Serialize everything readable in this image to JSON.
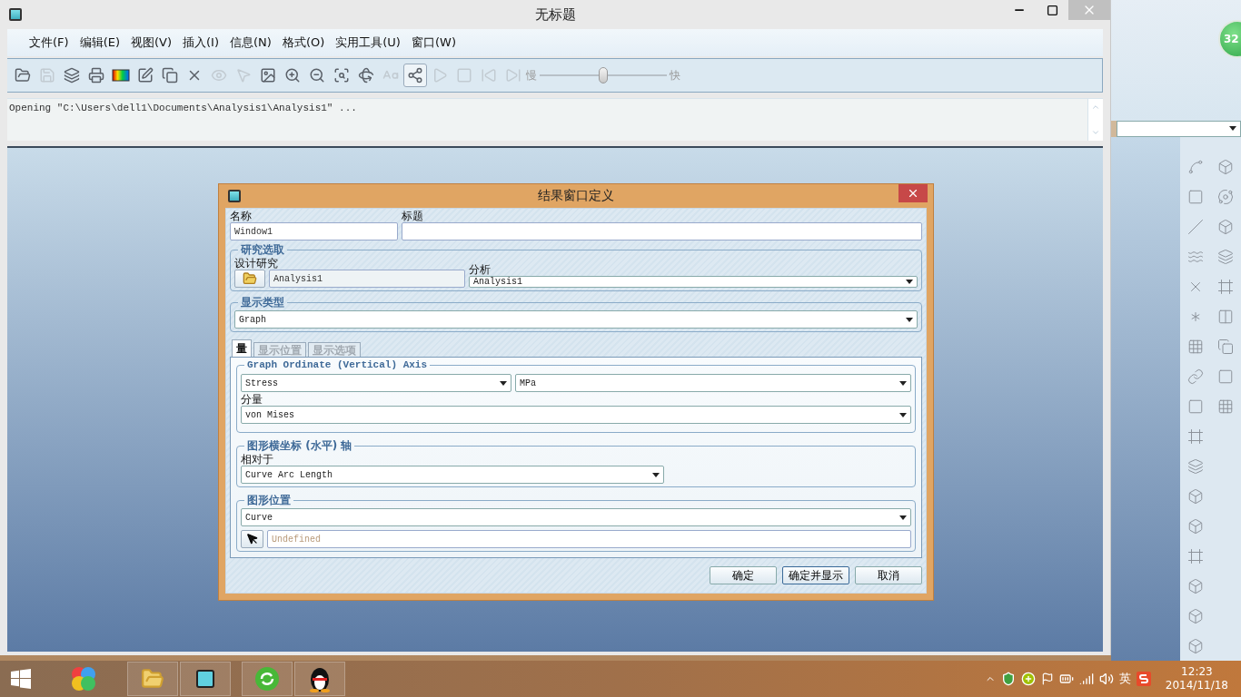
{
  "window": {
    "title": "无标题"
  },
  "menu": [
    "文件(F)",
    "编辑(E)",
    "视图(V)",
    "插入(I)",
    "信息(N)",
    "格式(O)",
    "实用工具(U)",
    "窗口(W)"
  ],
  "toolbar": {
    "tools": [
      {
        "disabled": false,
        "selected": false
      },
      {
        "disabled": true,
        "selected": false
      },
      {
        "disabled": false,
        "selected": false
      },
      {
        "disabled": false,
        "selected": false
      },
      {
        "disabled": false,
        "selected": false
      },
      {
        "disabled": false,
        "selected": false
      },
      {
        "disabled": false,
        "selected": false
      },
      {
        "disabled": false,
        "selected": false
      },
      {
        "disabled": true,
        "selected": false
      },
      {
        "disabled": true,
        "selected": false
      },
      {
        "disabled": false,
        "selected": false
      },
      {
        "disabled": false,
        "selected": false
      },
      {
        "disabled": false,
        "selected": false
      },
      {
        "disabled": false,
        "selected": false
      },
      {
        "disabled": false,
        "selected": false
      },
      {
        "disabled": true,
        "selected": false
      },
      {
        "disabled": false,
        "selected": true
      },
      {
        "disabled": true,
        "selected": false
      },
      {
        "disabled": true,
        "selected": false
      },
      {
        "disabled": true,
        "selected": false
      },
      {
        "disabled": true,
        "selected": false
      }
    ],
    "slow_label": "慢",
    "fast_label": "快",
    "speed": {
      "level": 0.5
    }
  },
  "output": {
    "text": "Opening \"C:\\Users\\dell1\\Documents\\Analysis1\\Analysis1\" ..."
  },
  "dialog": {
    "title": "结果窗口定义",
    "name_label": "名称",
    "name_value": "Window1",
    "title_label": "标题",
    "study_group": "研究选取",
    "design_study_label": "设计研究",
    "design_study_value": "Analysis1",
    "analysis_label": "分析",
    "analysis_value": "Analysis1",
    "display_type_group": "显示类型",
    "display_type_value": "Graph",
    "tabs": [
      {
        "label": "量",
        "selected": true,
        "disabled": false
      },
      {
        "label": "显示位置",
        "selected": false,
        "disabled": true
      },
      {
        "label": "显示选项",
        "selected": false,
        "disabled": true
      }
    ],
    "ordinate_group": "Graph Ordinate (Vertical) Axis",
    "quantity": "Stress",
    "unit": "MPa",
    "component_label": "分量",
    "component": "von Mises",
    "abscissa_group": "图形横坐标 (水平) 轴",
    "relative_label": "相对于",
    "relative": "Curve Arc Length",
    "location_group": "图形位置",
    "location": "Curve",
    "selection_placeholder": "Undefined",
    "buttons": [
      "确定",
      "确定并显示",
      "取消"
    ]
  },
  "background_app": {
    "badge": "32"
  },
  "taskbar": {
    "ime": "英",
    "time": "12:23",
    "date": "2014/11/18"
  }
}
